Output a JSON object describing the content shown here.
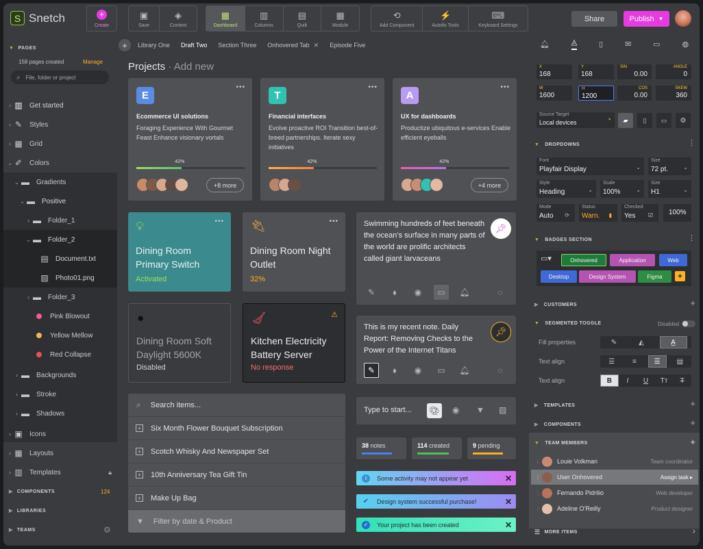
{
  "app": {
    "name": "Snetch",
    "logo_letter": "S"
  },
  "toolbar": {
    "create": "Create",
    "g1": [
      "Save",
      "Content"
    ],
    "g2": [
      "Dashboard",
      "Columns",
      "Quilt",
      "Module"
    ],
    "g3": [
      "Add Component",
      "Autofix Tools",
      "Keyboard Settings"
    ],
    "share": "Share",
    "publish": "Publish"
  },
  "sidebar": {
    "pages_h": "PAGES",
    "pages_count": "158 pages created",
    "manage": "Manage",
    "search_ph": "File, folder or project",
    "items": [
      "Get started",
      "Styles",
      "Grid",
      "Colors",
      "Gradients",
      "Positive",
      "Folder_1",
      "Folder_2",
      "Document.txt",
      "Photo01.png",
      "Folder_3",
      "Pink Blowout",
      "Yellow Mellow",
      "Red Collapse",
      "Backgrounds",
      "Stroke",
      "Shadows",
      "Icons",
      "Layouts",
      "Templates"
    ],
    "components_h": "COMPONENTS",
    "components_count": "124",
    "libraries_h": "LIBRARIES",
    "teams_h": "TEAMS"
  },
  "tabs": [
    "Library One",
    "Draft Two",
    "Section Three",
    "Onhovered Tab",
    "Episode Five"
  ],
  "projects": {
    "title": "Projects",
    "add": "· Add new"
  },
  "cards": [
    {
      "letter": "E",
      "color": "#5b8be6",
      "title": "Ecommerce UI solutions",
      "desc": "Foraging Experience With Gourmet Feast Enhance visionary vortals",
      "pct": "42%",
      "more": "+8 more",
      "bar": "linear-gradient(90deg,#9adf62,#5cc76f)"
    },
    {
      "letter": "T",
      "color": "#2fc3b4",
      "title": "Financial interfaces",
      "desc": "Evolve proactive ROI Transition best-of-breed partnerships. Iterate sexy initiatives",
      "pct": "42%",
      "more": "",
      "bar": "linear-gradient(90deg,#ffb347,#ff7f3e)"
    },
    {
      "letter": "A",
      "color": "#b89cf2",
      "title": "UX for dashboards",
      "desc": "Productize ubiquitous e-services Enable efficient eyeballs",
      "pct": "42%",
      "more": "+4 more",
      "bar": "linear-gradient(90deg,#f25bb2,#c56ef2)"
    }
  ],
  "progress": 0.42,
  "devices": [
    {
      "title": "Dining Room Primary Switch",
      "status": "Activated"
    },
    {
      "title": "Dining Room Night Outlet",
      "status": "32%"
    },
    {
      "title": "Dining Room Soft Daylight 5600K",
      "status": "Disabled"
    },
    {
      "title": "Kitchen Electricity Battery Server",
      "status": "No response"
    }
  ],
  "notes": [
    "Swimming hundreds of feet beneath the ocean’s surface in many parts of the world are prolific architects called giant larvaceans",
    "This is my recent note. Daily Report: Removing Checks to the Power of the Internet Titans"
  ],
  "type_ph": "Type to start...",
  "list": {
    "search": "Search items...",
    "items": [
      "Six Month Flower Bouquet Subscription",
      "Scotch Whisky And Newspaper Set",
      "10th Anniversary Tea Gift Tin",
      "Make Up Bag"
    ],
    "filter": "Filter by date & Product"
  },
  "stats": [
    {
      "n": "38",
      "l": "notes"
    },
    {
      "n": "114",
      "l": "created"
    },
    {
      "n": "9",
      "l": "pending"
    }
  ],
  "toasts": [
    "Some activity may not appear yet",
    "Design system successful purchase!",
    "Your project has been created"
  ],
  "rp": {
    "x": "168",
    "y": "168",
    "sin": "0.00",
    "angle": "0",
    "w": "1600",
    "h": "1200",
    "cos": "0.00",
    "skew": "360",
    "labels": {
      "x": "X",
      "y": "Y",
      "sin": "SIN",
      "angle": "ANGLE",
      "w": "W",
      "h": "H",
      "cos": "COS",
      "skew": "SKEW"
    },
    "src_l": "Source Target",
    "src_v": "Local devices",
    "dropdowns_h": "DROPDOWNS",
    "font_l": "Font",
    "font_v": "Playfair Display",
    "size_l": "Size",
    "size_v": "72 pt.",
    "style_l": "Style",
    "style_v": "Heading",
    "scale_l": "Scale",
    "scale_v": "100%",
    "size2_l": "Size",
    "size2_v": "H1",
    "mode_l": "Mode",
    "mode_v": "Auto",
    "status_l": "Status",
    "status_v": "Warn.",
    "checked_l": "Checked",
    "checked_v": "Yes",
    "pct_v": "100%",
    "badges_h": "BADGES SECTION",
    "chips": [
      "Onhovered",
      "Application",
      "Web",
      "Desktop",
      "Design System",
      "Figma"
    ],
    "customers_h": "CUSTOMERS",
    "segtog_h": "SEGMENTED TOGGLE",
    "disabled": "Disabled",
    "fill_l": "Fill properties",
    "align1_l": "Text align",
    "align2_l": "Text align",
    "templates_h": "TEMPLATES",
    "components_h": "COMPONENTS",
    "team_h": "TEAM MEMBERS",
    "team": [
      {
        "name": "Louie Volkman",
        "role": "Team coordinator"
      },
      {
        "name": "User Onhovered",
        "role": "Assign task"
      },
      {
        "name": "Fernando Pidrilio",
        "role": "Web developer"
      },
      {
        "name": "Adeline O’Reilly",
        "role": "Product designer"
      }
    ],
    "more_h": "MORE ITEMS"
  }
}
